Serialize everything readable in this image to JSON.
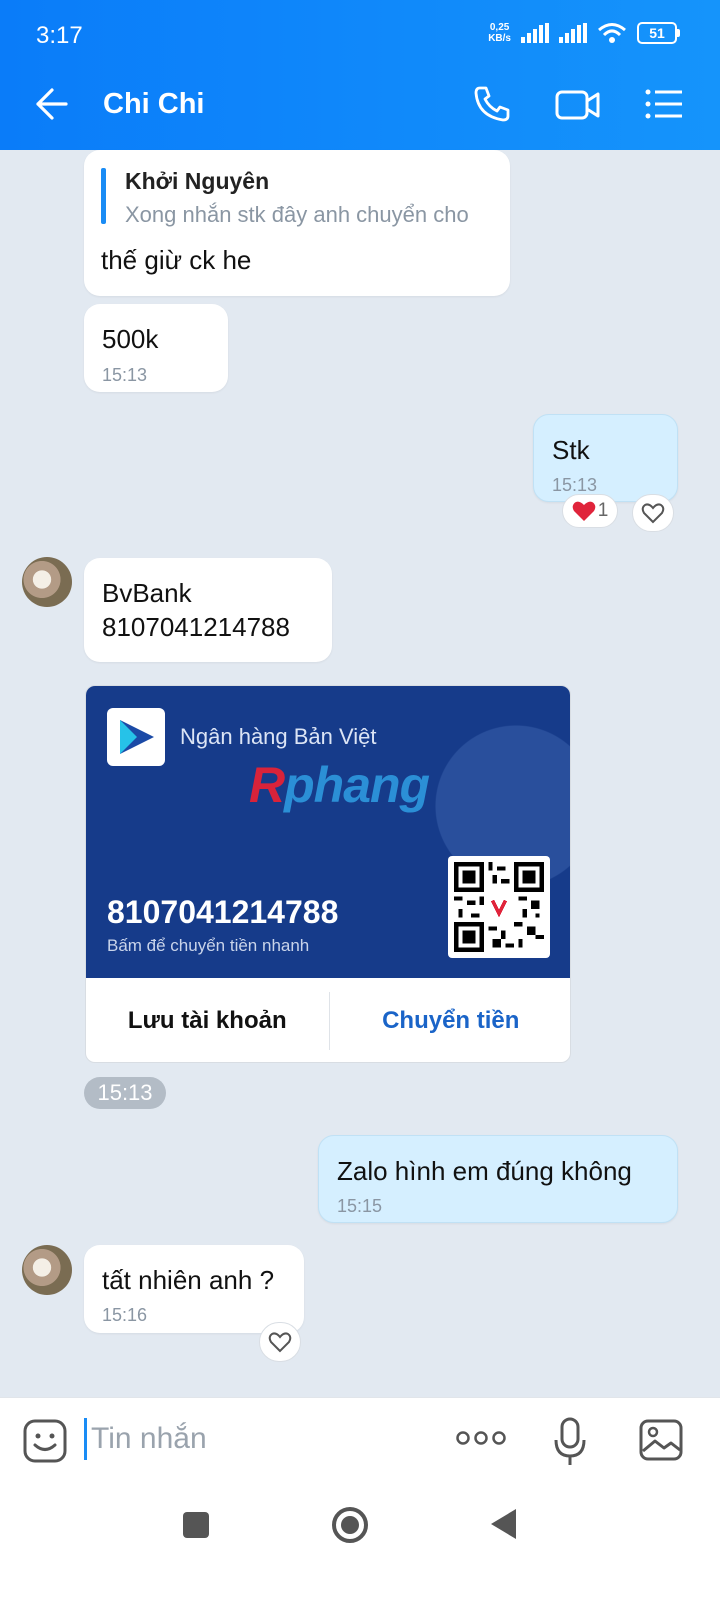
{
  "status_bar": {
    "time": "3:17",
    "net_speed_value": "0,25",
    "net_speed_unit": "KB/s",
    "battery": "51"
  },
  "header": {
    "title": "Chi Chi",
    "back_icon": "arrow-left-icon",
    "call_icon": "phone-icon",
    "video_icon": "video-camera-icon",
    "menu_icon": "list-menu-icon"
  },
  "messages": [
    {
      "quote_author": "Khởi Nguyên",
      "quote_text": "Xong nhắn stk đây anh chuyển cho",
      "text": "thế giừ ck he"
    },
    {
      "text": "500k",
      "time": "15:13"
    },
    {
      "text": "Stk",
      "time": "15:13",
      "reaction_count": "1"
    },
    {
      "text_line1": "BvBank",
      "text_line2": "8107041214788"
    },
    {
      "text": "Zalo hình em đúng không",
      "time": "15:15"
    },
    {
      "text": "tất nhiên anh ?",
      "time": "15:16"
    }
  ],
  "bank_card": {
    "bank_name": "Ngân hàng Bản Việt",
    "watermark_r": "R",
    "watermark_rest": "phang",
    "account_number": "8107041214788",
    "hint": "Bấm để chuyển tiền nhanh",
    "save_label": "Lưu tài khoản",
    "transfer_label": "Chuyển tiền",
    "primary_color": "#163b8a",
    "link_color": "#1a64c8"
  },
  "card_time": "15:13",
  "input": {
    "placeholder": "Tin nhắn"
  },
  "colors": {
    "header": "#0a7cf9",
    "chat_bg": "#e2e9f1",
    "my_bubble": "#d5efff",
    "reaction_heart": "#e0243b"
  }
}
